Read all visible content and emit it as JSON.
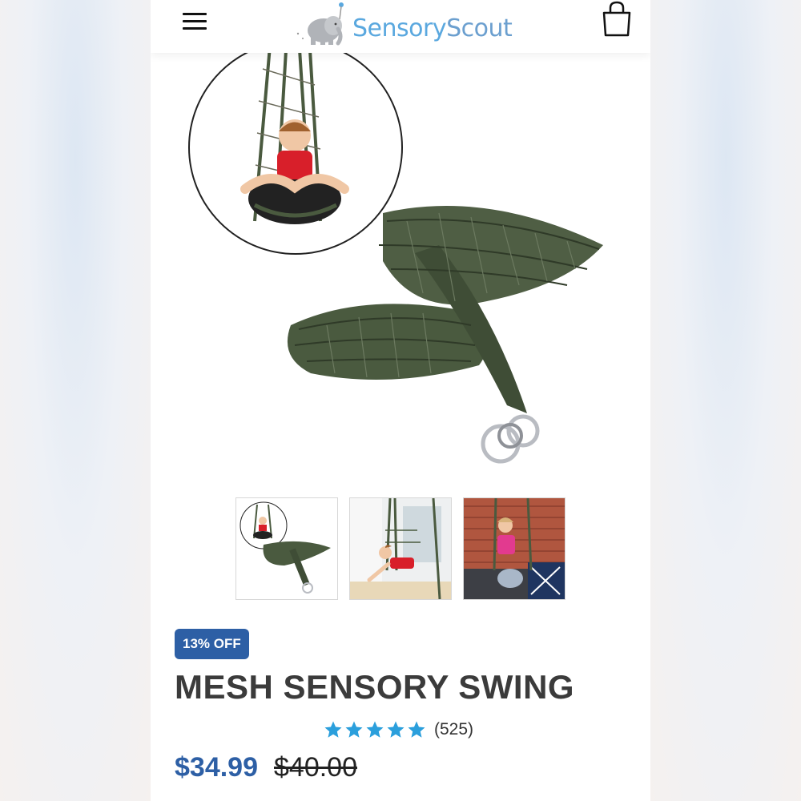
{
  "header": {
    "menu_icon": "hamburger-icon",
    "brand_part1": "Sensory",
    "brand_part2": "Scout",
    "cart_icon": "shopping-bag-icon"
  },
  "product": {
    "gallery_count": 3,
    "discount_badge": "13% OFF",
    "title": "MESH SENSORY SWING",
    "rating_stars": 5,
    "review_count": "(525)",
    "price": "$34.99",
    "compare_price": "$40.00"
  },
  "colors": {
    "brand_blue": "#2d5fa5",
    "logo_blue": "#5aa8df",
    "star_blue": "#2b9fdc",
    "swing_green": "#4a5a3f"
  }
}
